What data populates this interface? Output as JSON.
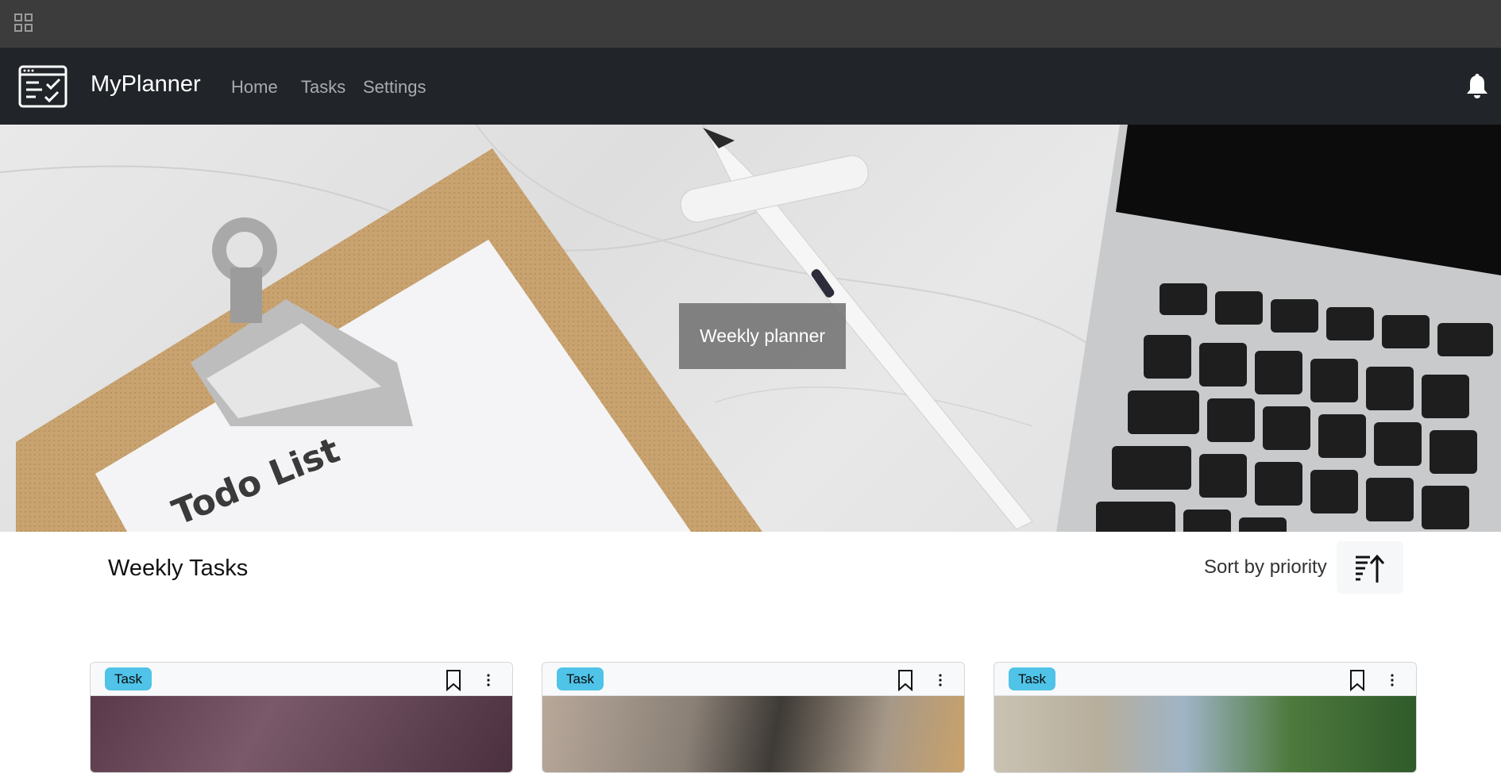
{
  "app": {
    "brand": "MyPlanner"
  },
  "nav": {
    "items": [
      {
        "label": "Home"
      },
      {
        "label": "Tasks"
      },
      {
        "label": "Settings"
      }
    ]
  },
  "hero": {
    "label": "Weekly planner",
    "clipboard_text": "Todo List"
  },
  "section": {
    "title": "Weekly Tasks",
    "sort_label": "Sort by priority"
  },
  "cards": [
    {
      "badge": "Task"
    },
    {
      "badge": "Task"
    },
    {
      "badge": "Task"
    }
  ],
  "icons": {
    "apps": "grid-icon",
    "logo": "checklist-window-icon",
    "bell": "bell-icon",
    "sort": "sort-priority-icon",
    "bookmark": "bookmark-icon",
    "more": "kebab-menu-icon"
  },
  "colors": {
    "system_bar": "#3c3c3c",
    "navbar": "#212529",
    "badge": "#4fc3e8"
  }
}
